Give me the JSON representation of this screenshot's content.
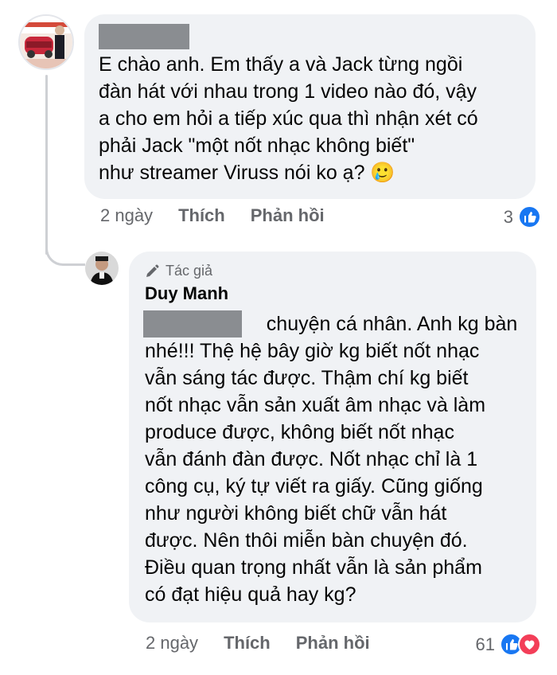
{
  "comment": {
    "lines": [
      "E chào anh. Em thấy a và      Jack từng ngồi",
      "đàn hát với nhau trong 1 video nào đó, vậy",
      "a cho em hỏi a tiếp xúc qua thì nhận xét có",
      "phải      Jack \"một nốt nhạc không biết\"",
      "như streamer Viruss nói ko ạ? 🥲"
    ],
    "time": "2 ngày",
    "like_label": "Thích",
    "reply_label": "Phản hồi",
    "reaction_count": "3"
  },
  "reply": {
    "author_badge": "Tác giả",
    "name": "Duy Manh",
    "lines": [
      "                      chuyện cá nhân. Anh kg bàn",
      "nhé!!! Thệ hệ bây giờ kg biết nốt nhạc",
      "vẫn sáng tác được. Thậm chí kg biết",
      "nốt nhạc vẫn sản xuất âm nhạc và làm",
      "produce được, không biết nốt nhạc",
      "vẫn đánh đàn được. Nốt nhạc chỉ là 1",
      "công cụ, ký tự viết ra giấy. Cũng giống",
      "như người không biết chữ vẫn hát",
      "được. Nên thôi miễn bàn chuyện đó.",
      "Điều quan trọng nhất vẫn là sản phẩm",
      "có đạt hiệu quả hay kg?"
    ],
    "time": "2 ngày",
    "like_label": "Thích",
    "reply_label": "Phản hồi",
    "reaction_count": "61"
  },
  "colors": {
    "bubble": "#f0f2f5",
    "like": "#1877f2",
    "love": "#f33e58",
    "secondary_text": "#65676b",
    "redaction": "#8a8d91"
  },
  "icons": [
    "like-reaction-icon",
    "love-reaction-icon",
    "pen-icon"
  ]
}
